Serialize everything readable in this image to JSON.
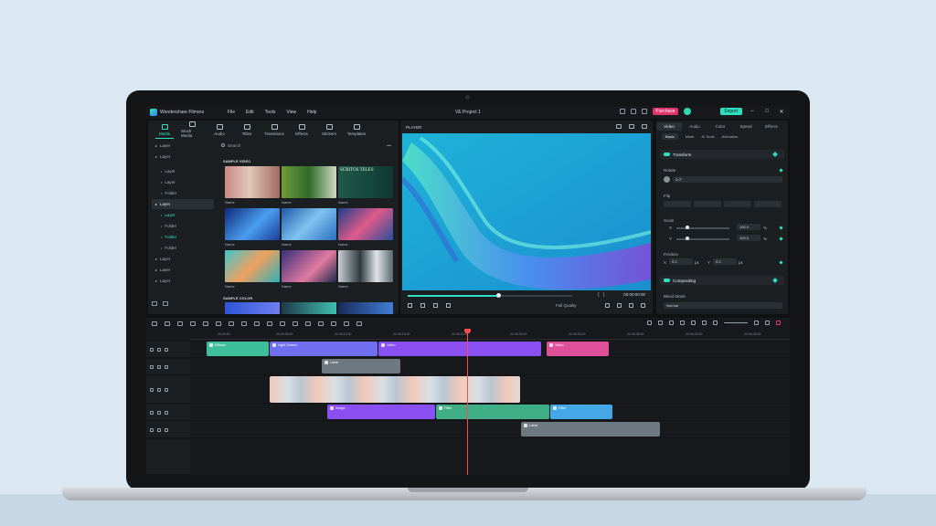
{
  "app": {
    "name": "Wondershare Filmora",
    "project_title": "VE Project 1",
    "menu": [
      "File",
      "Edit",
      "Tools",
      "View",
      "Help"
    ],
    "purchase_label": "Purchase",
    "export_label": "Export",
    "accent": "#2fe0c0",
    "purchase_color": "#e0356b"
  },
  "media_tabs": [
    "Media",
    "Stock Media",
    "Audio",
    "Titles",
    "Transitions",
    "Effects",
    "Stickers",
    "Templates"
  ],
  "tree": {
    "items": [
      {
        "label": "Layer",
        "level": 0
      },
      {
        "label": "Layer",
        "level": 0
      },
      {
        "label": "Layer",
        "level": 1
      },
      {
        "label": "Layer",
        "level": 1
      },
      {
        "label": "Folder",
        "level": 1
      },
      {
        "label": "Layer",
        "level": 0,
        "selected": true
      },
      {
        "label": "Layer",
        "level": 1,
        "cyan": true
      },
      {
        "label": "Folder",
        "level": 1
      },
      {
        "label": "Folder",
        "level": 1,
        "cyan": true
      },
      {
        "label": "Folder",
        "level": 1
      },
      {
        "label": "Layer",
        "level": 0
      },
      {
        "label": "Layer",
        "level": 0
      },
      {
        "label": "Layer",
        "level": 0
      }
    ]
  },
  "media": {
    "search_placeholder": "Search",
    "section_video": "SAMPLE VIDEO",
    "section_color": "SAMPLE COLOR",
    "thumb_names": [
      "Name",
      "Name",
      "Name",
      "Name",
      "Name",
      "Name",
      "Name",
      "Name",
      "Name"
    ],
    "thumb3_text": "SCRITOS TELES"
  },
  "player": {
    "label": "PLAYER",
    "timecode": "00:00:00:00",
    "quality": "Full Quality",
    "progress": 0.55
  },
  "inspector": {
    "tabs": [
      "Video",
      "Audio",
      "Color",
      "Speed",
      "Effects"
    ],
    "subtabs": [
      "Basic",
      "Mask",
      "AI Tools",
      "Animation"
    ],
    "transform_label": "Transform",
    "rotate_label": "Rotate",
    "rotate_value": "0.0°",
    "flip_label": "Flip",
    "scale_label": "Scale",
    "scale_x_label": "X",
    "scale_y_label": "Y",
    "scale_x_value": "100.0",
    "scale_y_value": "100.0",
    "scale_unit": "%",
    "position_label": "Position",
    "position_x_label": "X",
    "position_y_label": "Y",
    "position_x_value": "0.0",
    "position_y_value": "0.0",
    "position_unit": "px",
    "compositing_label": "Compositing",
    "blend_mode_label": "Blend Mode",
    "blend_mode_value": "Normal"
  },
  "timeline": {
    "ruler_labels": [
      "00:00:00",
      "00:00:05:00",
      "00:00:10:00",
      "00:00:15:00",
      "00:00:20:00",
      "00:00:25:00",
      "00:00:30:00",
      "00:00:35:00",
      "00:00:40:00",
      "00:00:45:00"
    ],
    "clips": {
      "effects": "Effects",
      "light_screen": "Light Screen",
      "video_a": "Video",
      "video_b": "Video",
      "label_a": "Label",
      "image": "Image",
      "filter": "Filter",
      "filter_b": "Filter",
      "label_b": "Label"
    },
    "colors": {
      "teal": "#3fbf99",
      "blue": "#6f6ff0",
      "purple": "#8a4ff0",
      "pink": "#e0509a",
      "gray": "#6e7881",
      "green": "#3fae86",
      "lightblue": "#44a8e6"
    }
  }
}
